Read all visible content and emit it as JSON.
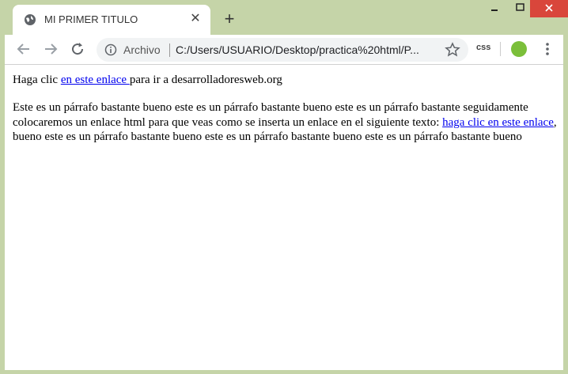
{
  "tab": {
    "title": "MI PRIMER TITULO",
    "favicon": "globe-icon"
  },
  "toolbar": {
    "security_label": "Archivo",
    "url": "C:/Users/USUARIO/Desktop/practica%20html/P...",
    "extension_label": "css"
  },
  "content": {
    "p1_before": "Haga clic ",
    "p1_link": "en este enlace ",
    "p1_after": "para ir a desarrolladoresweb.org",
    "p2_before": "Este es un párrafo bastante bueno este es un párrafo bastante bueno este es un párrafo bastante seguidamente colocaremos un enlace html para que veas como se inserta un enlace en el siguiente texto: ",
    "p2_link": "haga clic en este enlace",
    "p2_after": ", bueno este es un párrafo bastante bueno este es un párrafo bastante bueno este es un párrafo bastante bueno"
  },
  "colors": {
    "frame": "#c5d4a8",
    "link": "#0000ee",
    "close": "#d9463b"
  }
}
